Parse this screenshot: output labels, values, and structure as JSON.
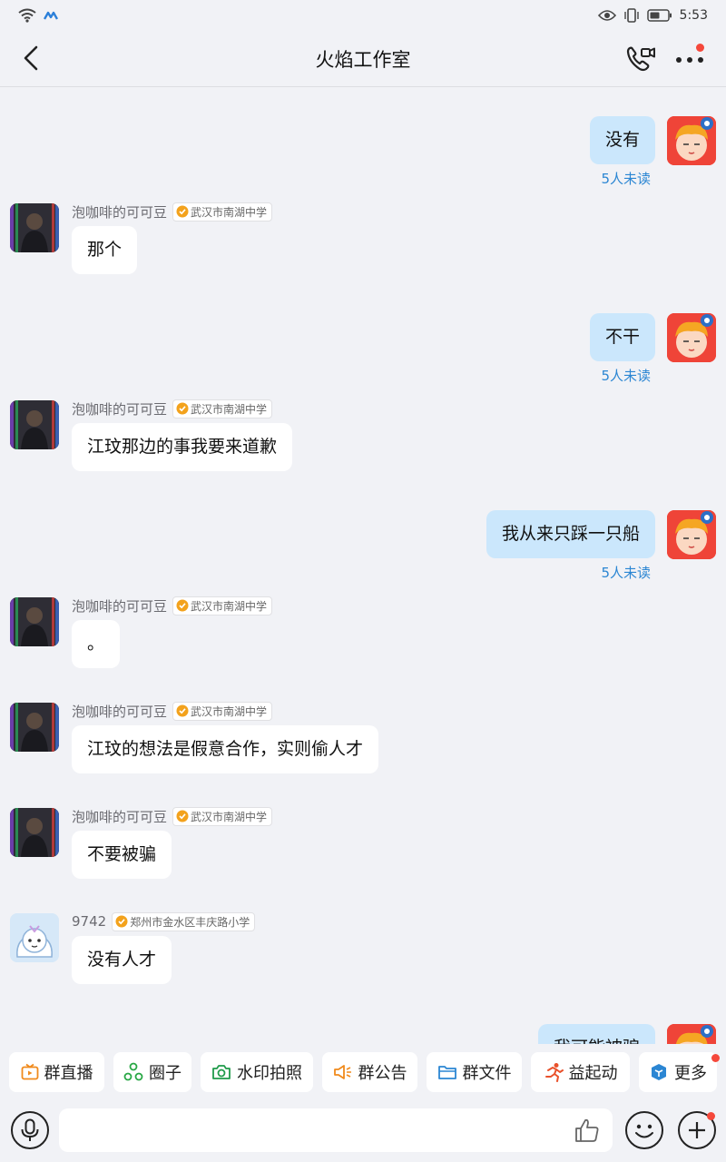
{
  "status_bar": {
    "time": "5:53"
  },
  "header": {
    "title": "火焰工作室"
  },
  "messages": [
    {
      "side": "self",
      "text": "没有",
      "unread": "5人未读"
    },
    {
      "side": "other",
      "sender": "泡咖啡的可可豆",
      "school": "武汉市南湖中学",
      "text": "那个"
    },
    {
      "side": "self",
      "text": "不干",
      "unread": "5人未读"
    },
    {
      "side": "other",
      "sender": "泡咖啡的可可豆",
      "school": "武汉市南湖中学",
      "text": "江玟那边的事我要来道歉"
    },
    {
      "side": "self",
      "text": "我从来只踩一只船",
      "unread": "5人未读"
    },
    {
      "side": "other",
      "sender": "泡咖啡的可可豆",
      "school": "武汉市南湖中学",
      "text": "。"
    },
    {
      "side": "other",
      "sender": "泡咖啡的可可豆",
      "school": "武汉市南湖中学",
      "text": "江玟的想法是假意合作，实则偷人才"
    },
    {
      "side": "other",
      "sender": "泡咖啡的可可豆",
      "school": "武汉市南湖中学",
      "text": "不要被骗"
    },
    {
      "side": "other",
      "sender": "9742",
      "school": "郑州市金水区丰庆路小学",
      "text": "没有人才"
    },
    {
      "side": "self",
      "text": "我可能被骗",
      "unread": ""
    }
  ],
  "toolbar": {
    "items": [
      {
        "label": "群直播",
        "icon": "tv-icon"
      },
      {
        "label": "圈子",
        "icon": "circle-group-icon"
      },
      {
        "label": "水印拍照",
        "icon": "camera-icon"
      },
      {
        "label": "群公告",
        "icon": "megaphone-icon"
      },
      {
        "label": "群文件",
        "icon": "folder-icon"
      },
      {
        "label": "益起动",
        "icon": "runner-icon"
      },
      {
        "label": "更多",
        "icon": "more-apps-icon"
      }
    ]
  },
  "input": {
    "placeholder": ""
  },
  "colors": {
    "self_bubble": "#cbe7fc",
    "other_bubble": "#ffffff",
    "unread_text": "#2b86d3",
    "badge": "#f5483b",
    "verified": "#f3a21c"
  }
}
